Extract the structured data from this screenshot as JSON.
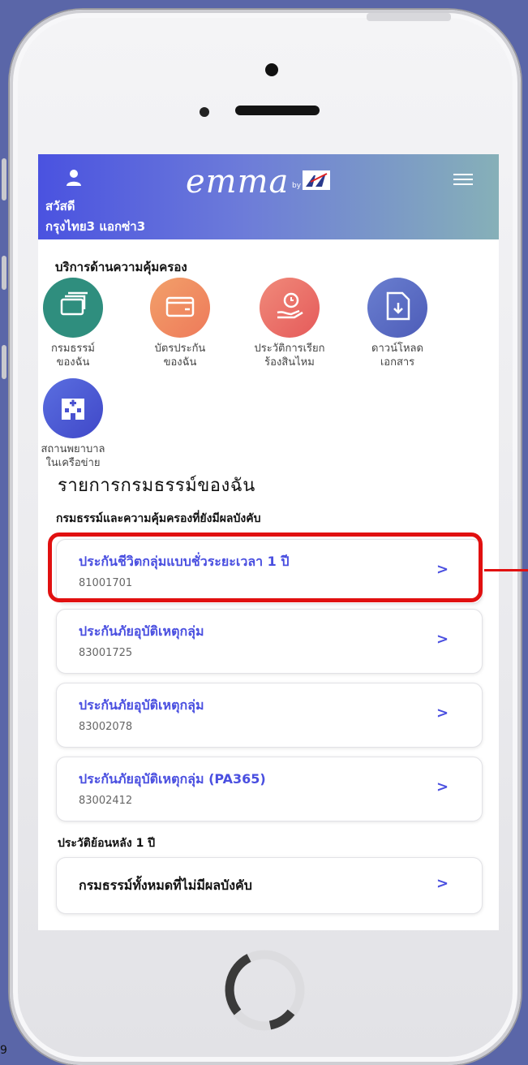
{
  "header": {
    "logo": "emma",
    "logo_by": "by",
    "brand": "AXA",
    "greeting": "สวัสดี",
    "user_name": "กรุงไทย3 แอกซ่า3"
  },
  "services": {
    "title": "บริการด้านความคุ้มครอง",
    "items": [
      {
        "line1": "กรมธรรม์",
        "line2": "ของฉัน",
        "color": "#2f8e7e"
      },
      {
        "line1": "บัตรประกัน",
        "line2": "ของฉัน",
        "color": "#ee8a62"
      },
      {
        "line1": "ประวัติการเรียก",
        "line2": "ร้องสินไหม",
        "color": "#e5726a"
      },
      {
        "line1": "ดาวน์โหลด",
        "line2": "เอกสาร",
        "color": "#5d6ec0"
      },
      {
        "line1": "สถานพยาบาล",
        "line2": "ในเครือข่าย",
        "color": "#4d58d6"
      }
    ]
  },
  "policies": {
    "title": "รายการกรมธรรม์ของฉัน",
    "subtitle": "กรมธรรม์และความคุ้มครองที่ยังมีผลบังคับ",
    "items": [
      {
        "name": "ประกันชีวิตกลุ่มแบบชั่วระยะเวลา 1 ปี",
        "number": "81001701",
        "chevron": ">"
      },
      {
        "name": "ประกันภัยอุบัติเหตุกลุ่ม",
        "number": "83001725",
        "chevron": ">"
      },
      {
        "name": "ประกันภัยอุบัติเหตุกลุ่ม",
        "number": "83002078",
        "chevron": ">"
      },
      {
        "name": "ประกันภัยอุบัติเหตุกลุ่ม (PA365)",
        "number": "83002412",
        "chevron": ">"
      }
    ]
  },
  "history": {
    "title": "ประวัติย้อนหลัง 1 ปี",
    "item": {
      "name": "กรมธรรม์ทั้งหมดที่ไม่มีผลบังคับ",
      "chevron": ">"
    }
  },
  "page_number": "9",
  "colors": {
    "accent": "#4a4fe0",
    "highlight": "#e11010"
  }
}
